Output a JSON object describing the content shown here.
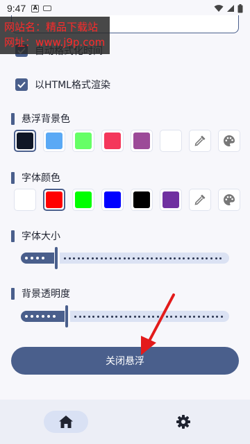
{
  "status": {
    "time": "9:47",
    "notif_letter": "A"
  },
  "watermark": {
    "line1": "网站名：精品下载站",
    "line2": "网址：www.j9p.com"
  },
  "checkboxes": [
    {
      "label": "自动格式化时间",
      "checked": true
    },
    {
      "label": "以HTML格式渲染",
      "checked": true
    }
  ],
  "bg_color": {
    "title": "悬浮背景色",
    "swatches": [
      "#0f1726",
      "#5aa9f5",
      "#66ff66",
      "#f4375b",
      "#9c4a98",
      "#ffffff"
    ],
    "selected_index": 0
  },
  "font_color": {
    "title": "字体颜色",
    "swatches": [
      "#ffffff",
      "#ff0000",
      "#00ff00",
      "#0000ff",
      "#000000",
      "#7030a0"
    ],
    "selected_index": 1
  },
  "font_size": {
    "title": "字体大小",
    "level": 0.17
  },
  "bg_opacity": {
    "title": "背景透明度",
    "level": 0.22
  },
  "close_button": {
    "label": "关闭悬浮"
  },
  "nav": {
    "items": [
      "home-icon",
      "gear-icon"
    ],
    "active": "home-icon"
  },
  "accent": "#4a5f8c",
  "annotation_arrow_color": "#e31b1b"
}
